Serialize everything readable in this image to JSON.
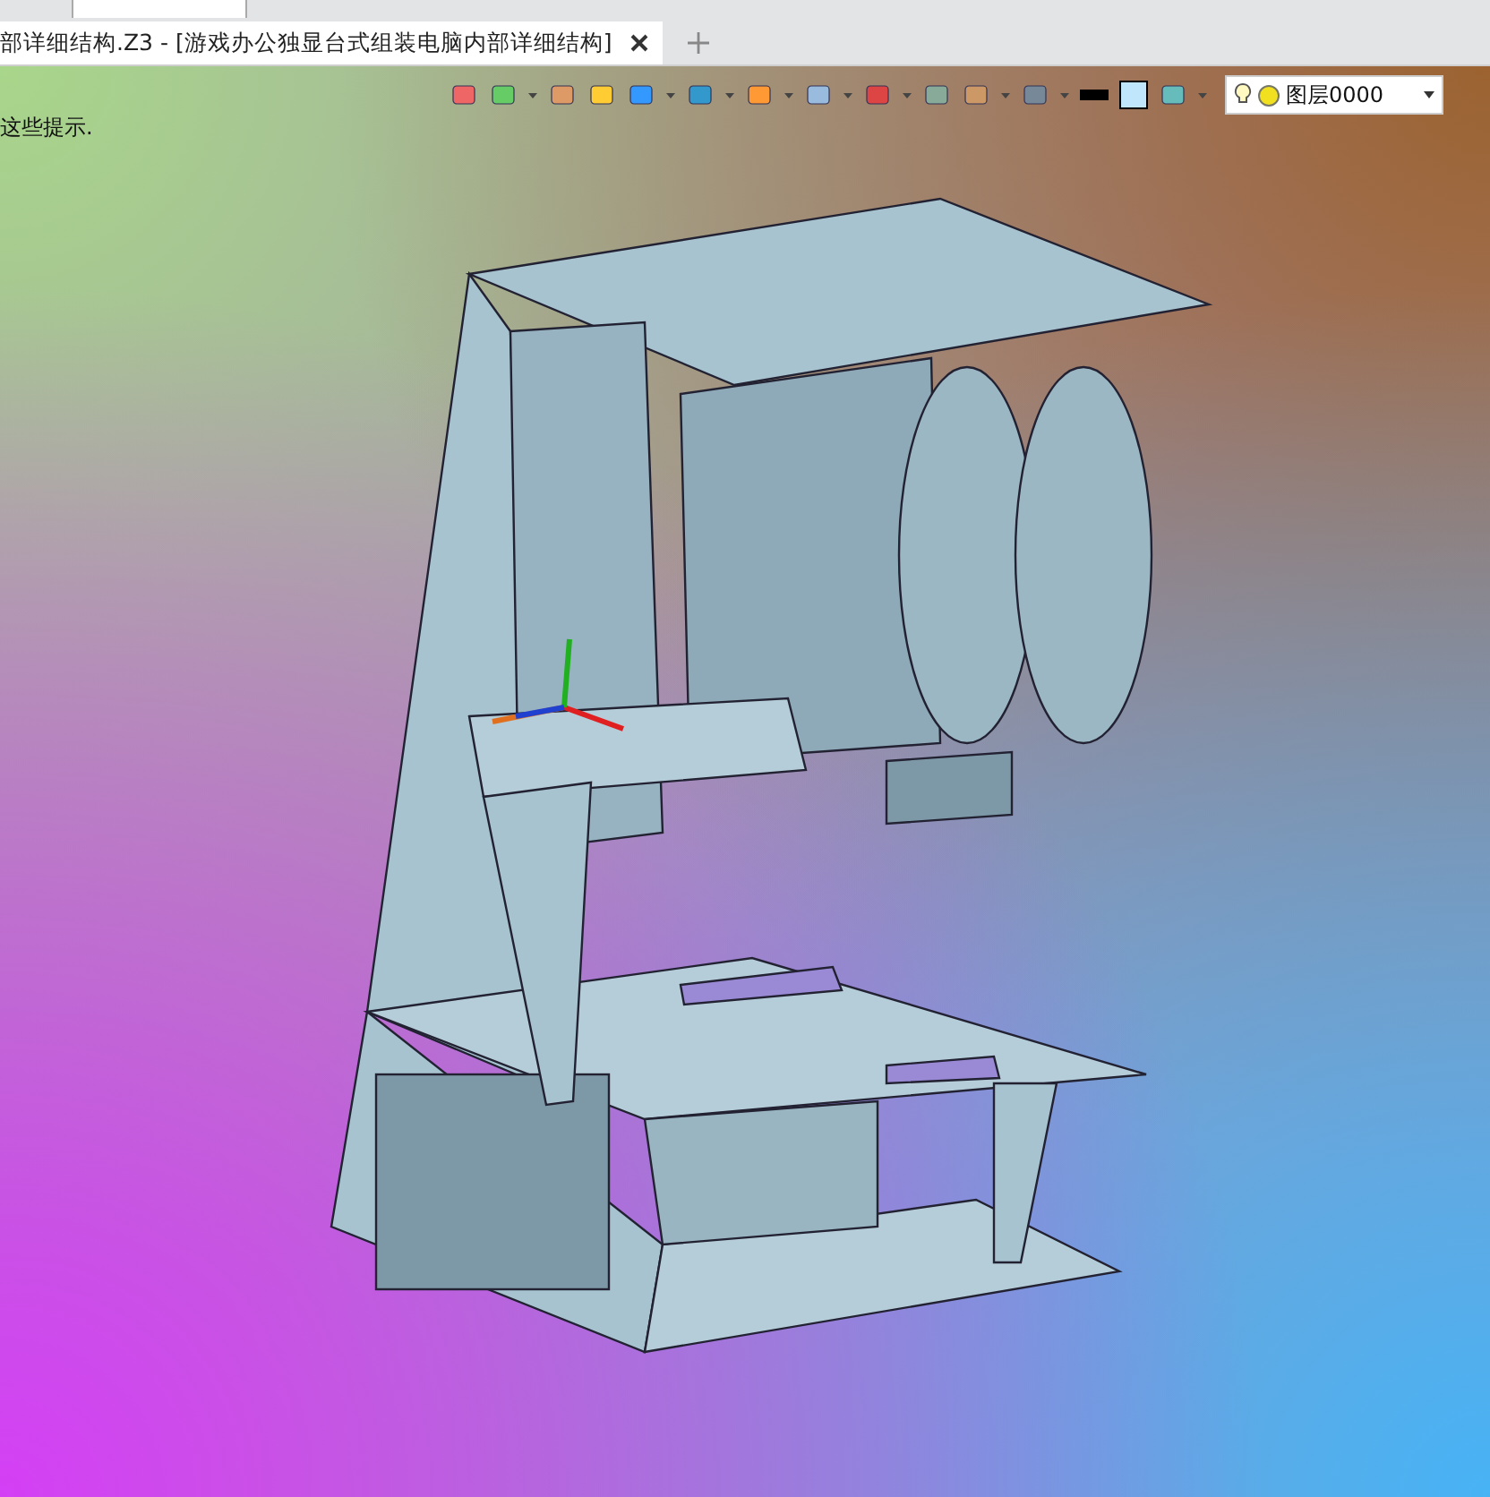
{
  "tabs": [
    {
      "label": "部详细结构.Z3 - [游戏办公独显台式组装电脑内部详细结构]",
      "selected": true
    }
  ],
  "viewport": {
    "hint": "这些提示.",
    "layer": {
      "value": "图层0000"
    }
  }
}
